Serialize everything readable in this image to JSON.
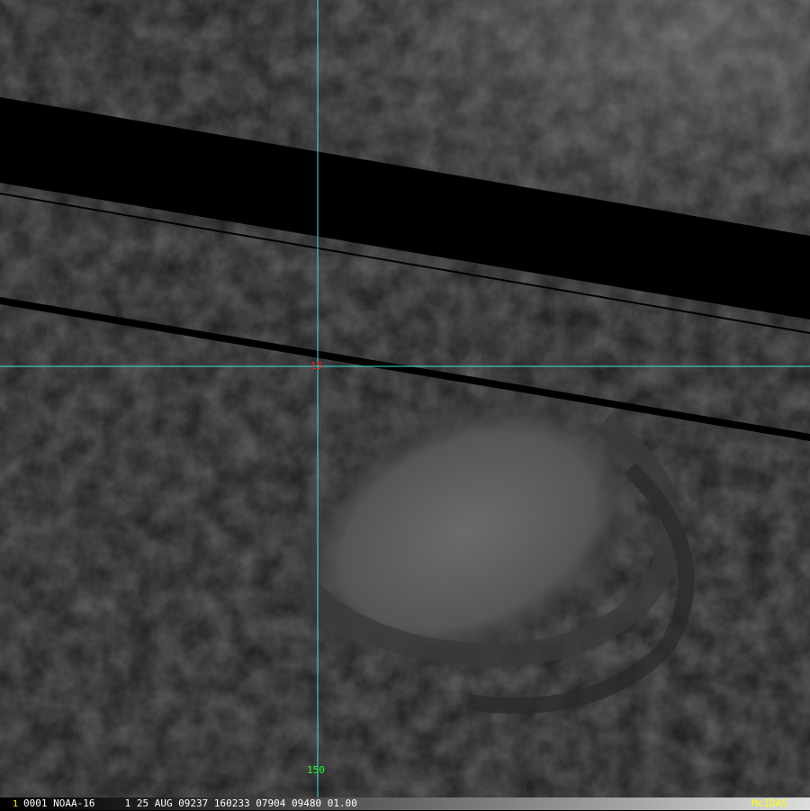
{
  "image": {
    "description_colors": {
      "cursor_line": "#40e0e0",
      "lat_label": "#ff2020",
      "lon_label": "#20ff20",
      "brand": "#ffff00"
    }
  },
  "labels": {
    "lat": "15",
    "lon": "150"
  },
  "status_bar": {
    "frame": "1",
    "text": "0001 NOAA-16     1 25 AUG 09237 160233 07904 09480 01.00",
    "brand": "McIDAS"
  }
}
